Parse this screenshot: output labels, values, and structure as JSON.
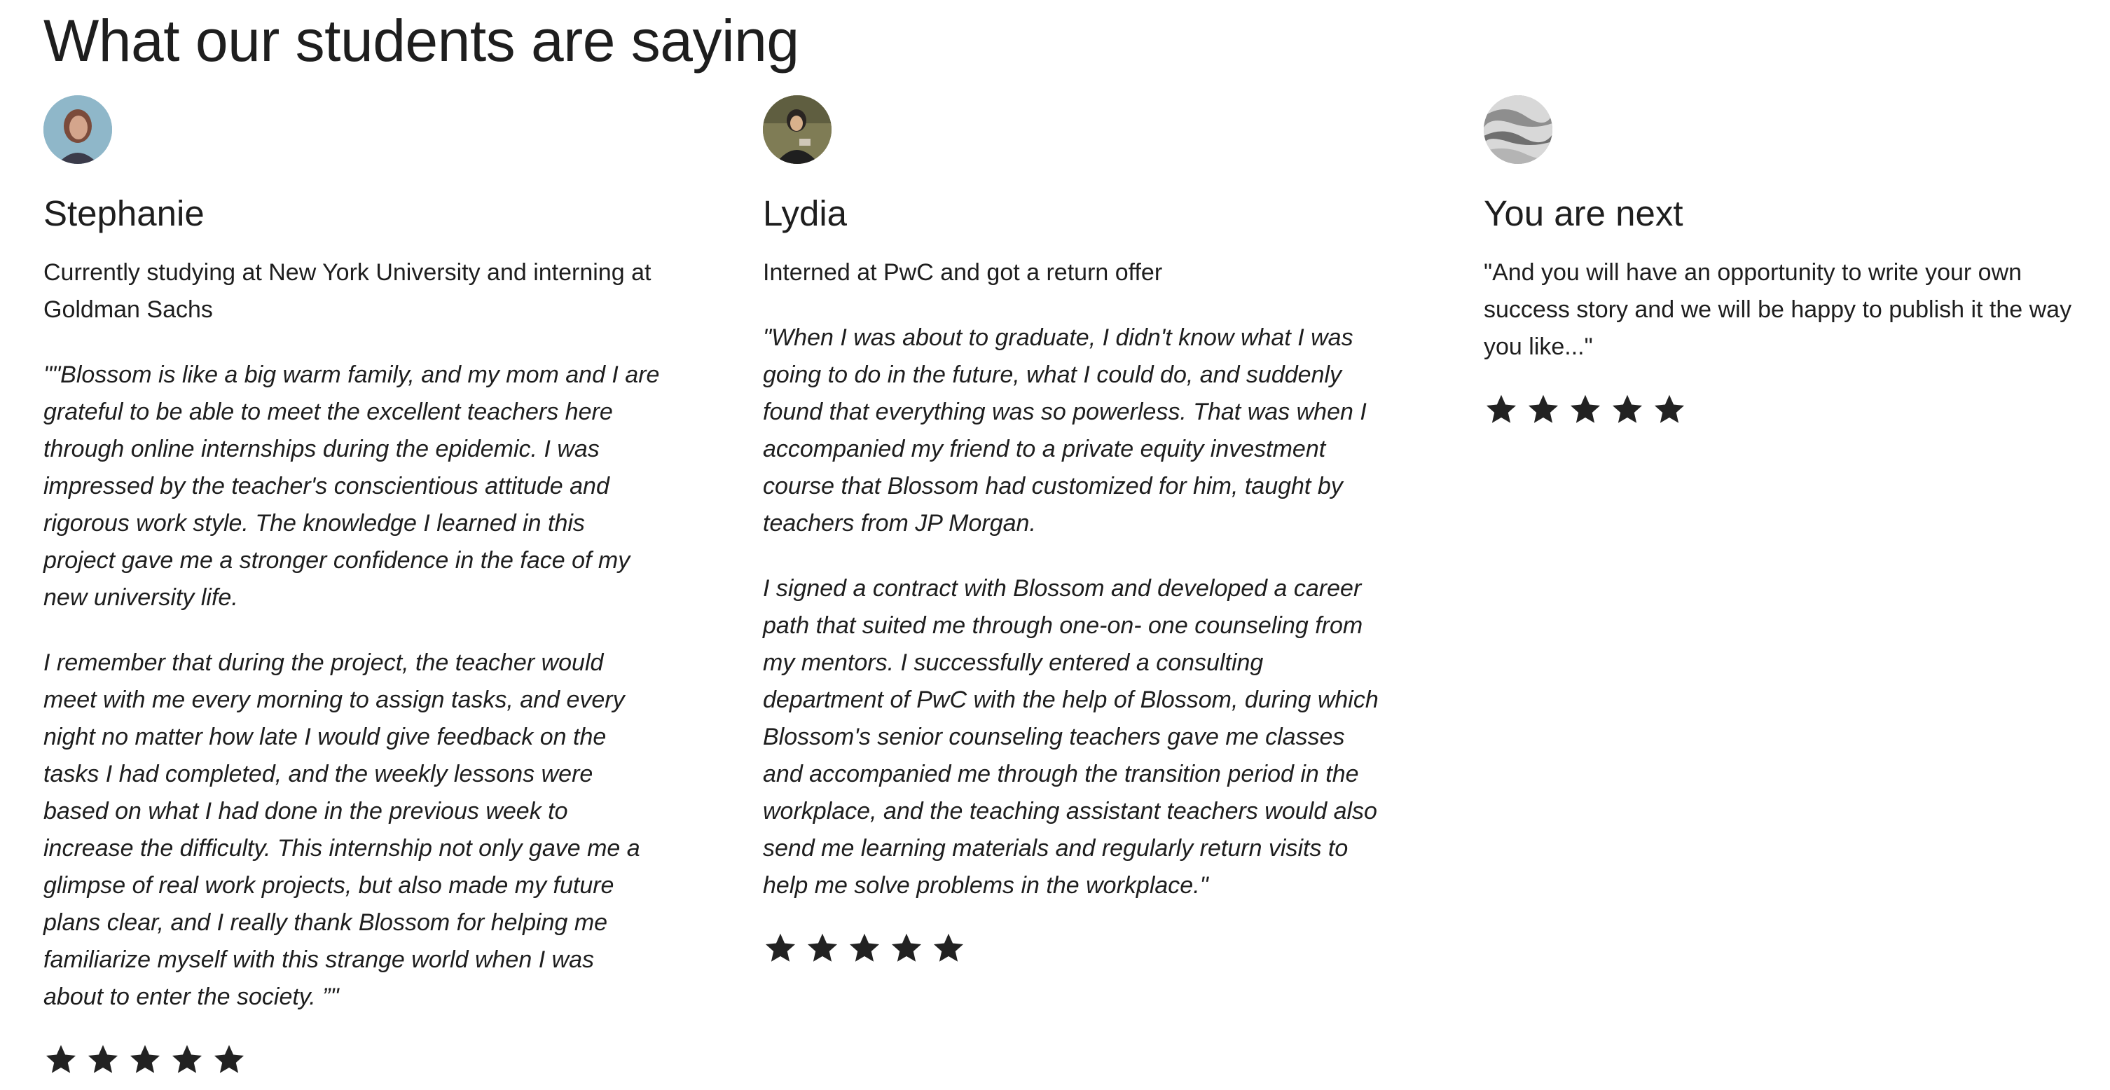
{
  "section": {
    "title": "What our students are saying"
  },
  "colors": {
    "text": "#1e1e1e",
    "star": "#222222",
    "background": "#ffffff"
  },
  "testimonials": [
    {
      "avatar_icon": "student-portrait",
      "name": "Stephanie",
      "subtitle": "Currently studying at New York University and interning at Goldman Sachs",
      "quote_style": "italic",
      "paragraphs": [
        "\"\"Blossom is like a big warm family, and my mom and I are grateful to be able to meet the excellent teachers here through online internships during the epidemic. I was impressed by the teacher's conscientious attitude and rigorous work style. The knowledge I learned in this project gave me a stronger confidence in the face of my new university life.",
        "I remember that during the project, the teacher would meet with me every morning to assign tasks, and every night no matter how late I would give feedback on the tasks I had completed, and the weekly lessons were based on what I had done in the previous week to increase the difficulty. This internship not only gave me a glimpse of real work projects, but also made my future plans clear, and I really thank Blossom for helping me familiarize myself with this strange world when I was about to enter the society. ”\""
      ],
      "rating": 5
    },
    {
      "avatar_icon": "student-portrait",
      "name": "Lydia",
      "subtitle": "Interned at PwC and got a return offer",
      "quote_style": "italic",
      "paragraphs": [
        "\"When I was about to graduate, I didn't know what I was going to do in the future, what I could do, and suddenly found that everything was so powerless. That was when I accompanied my friend to a private equity investment course that Blossom had customized for him, taught by teachers from JP Morgan.",
        "I signed a contract with Blossom and developed a career path that suited me through one-on- one counseling from my mentors. I successfully entered a consulting department of PwC with the help of Blossom,  during which Blossom's senior counseling teachers gave me classes and accompanied me through the transition period in the workplace, and the teaching assistant teachers would also send me learning materials and regularly return visits to help me solve problems in the workplace.\""
      ],
      "rating": 5
    },
    {
      "avatar_icon": "abstract-texture",
      "name": "You are next",
      "subtitle": "",
      "quote_style": "normal",
      "paragraphs": [
        "\"And you will have an opportunity to write your own success story and we will be happy to publish it the way you like...\""
      ],
      "rating": 5
    }
  ]
}
